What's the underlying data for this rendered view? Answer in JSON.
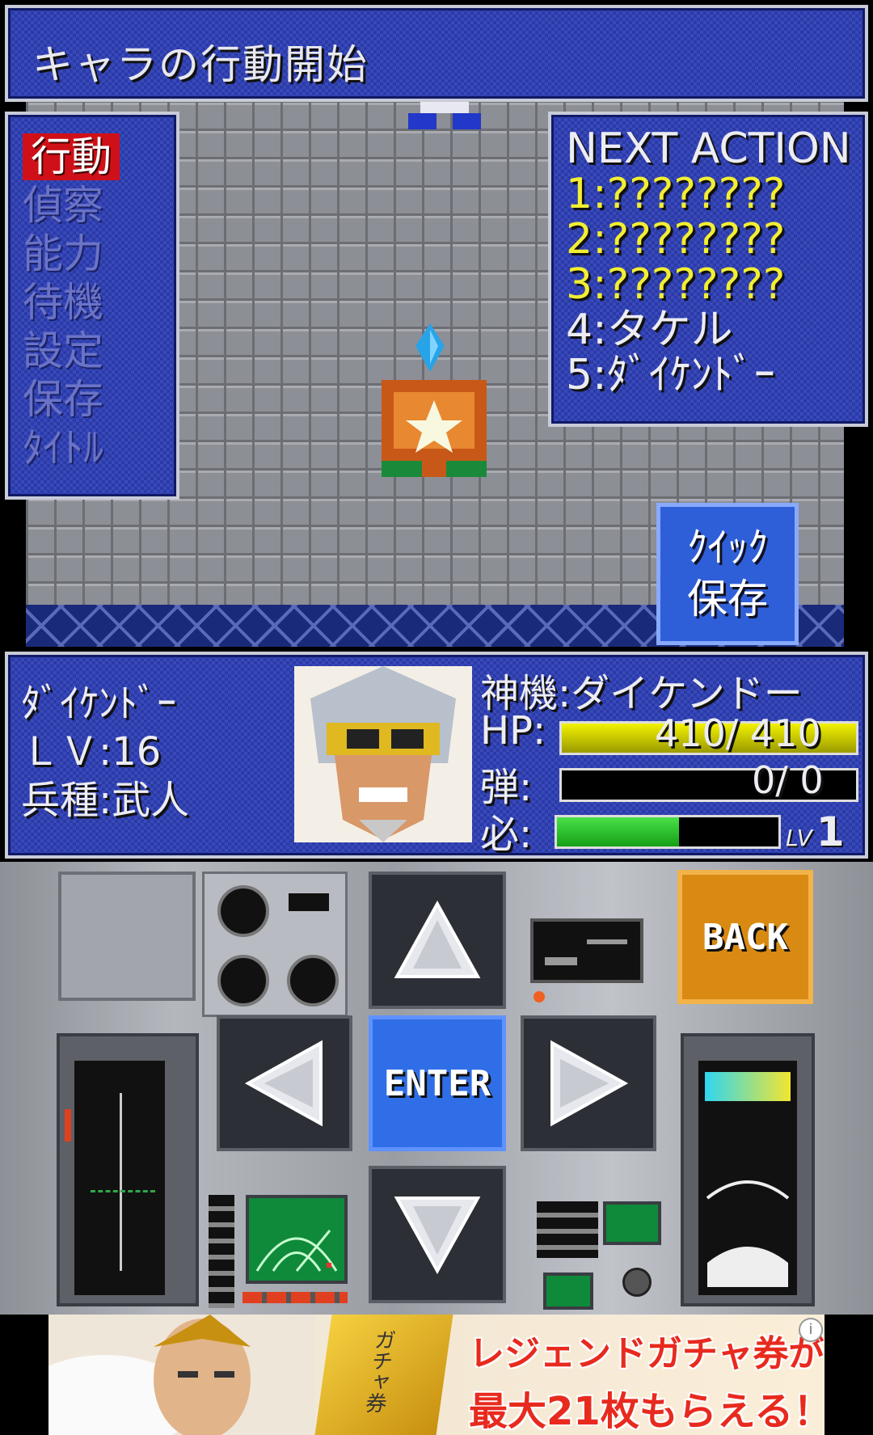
{
  "header": {
    "title": "キャラの行動開始"
  },
  "menu": {
    "items": [
      {
        "label": "行動",
        "active": true
      },
      {
        "label": "偵察",
        "active": false
      },
      {
        "label": "能力",
        "active": false
      },
      {
        "label": "待機",
        "active": false
      },
      {
        "label": "設定",
        "active": false
      },
      {
        "label": "保存",
        "active": false
      },
      {
        "label": "ﾀｲﾄﾙ",
        "active": false
      }
    ]
  },
  "next_action": {
    "title": "NEXT ACTION",
    "items": [
      "1:????????",
      "2:????????",
      "3:????????",
      "4:タケル",
      "5:ﾀﾞｲｹﾝﾄﾞｰ"
    ]
  },
  "quick_save": {
    "line1": "ｸｲｯｸ",
    "line2": "保存"
  },
  "unit": {
    "name": "ﾀﾞｲｹﾝﾄﾞｰ",
    "level": "ＬＶ:16",
    "class": "兵種:武人",
    "machine": "神機:ダイケンドー",
    "hp_label": "HP:",
    "hp_text": "410/ 410",
    "hp_fraction": 1.0,
    "ammo_label": "弾:",
    "ammo_text": "0/ 0",
    "ammo_fraction": 0.0,
    "special_label": "必:",
    "special_fraction": 0.55,
    "special_lv_label": "LV",
    "special_lv": "1"
  },
  "controls": {
    "back": "BACK",
    "enter": "ENTER"
  },
  "ad": {
    "line1": "レジェンドガチャ券が",
    "line2": "最大21枚もらえる！",
    "ticket_text": "ガチャ券",
    "info_icon": "i"
  },
  "colors": {
    "panel_blue": "#2a3aa8",
    "menu_active_red": "#d01018",
    "highlight_yellow": "#f2ee33",
    "enter_blue": "#2f6ee6",
    "back_orange": "#d98a12"
  }
}
